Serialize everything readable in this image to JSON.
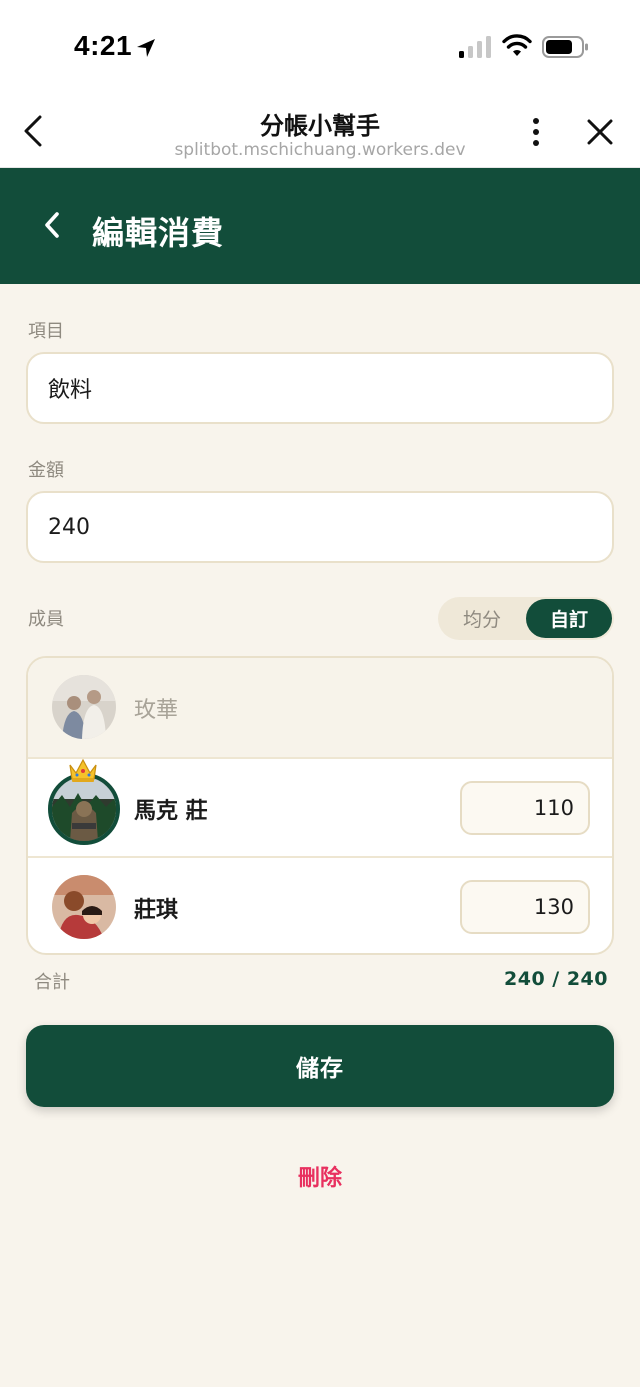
{
  "status_bar": {
    "time": "4:21",
    "icons": [
      "location-arrow-icon",
      "cellular-signal-icon",
      "wifi-icon",
      "battery-icon"
    ]
  },
  "browser": {
    "title": "分帳小幫手",
    "url": "splitbot.mschichuang.workers.dev"
  },
  "header": {
    "title": "編輯消費"
  },
  "form": {
    "item_label": "項目",
    "item_value": "飲料",
    "amount_label": "金額",
    "amount_value": "240",
    "members_label": "成員",
    "split_modes": {
      "even": "均分",
      "custom": "自訂",
      "selected": "custom"
    }
  },
  "members": [
    {
      "name": "玫華",
      "included": false,
      "amount": null
    },
    {
      "name": "馬克 莊",
      "included": true,
      "amount": "110",
      "crown": true
    },
    {
      "name": "莊琪",
      "included": true,
      "amount": "130"
    }
  ],
  "total": {
    "label": "合計",
    "value": "240 / 240"
  },
  "actions": {
    "save": "儲存",
    "delete": "刪除"
  },
  "colors": {
    "primary": "#124d3a",
    "background": "#f8f4ec",
    "danger": "#e8305f"
  }
}
